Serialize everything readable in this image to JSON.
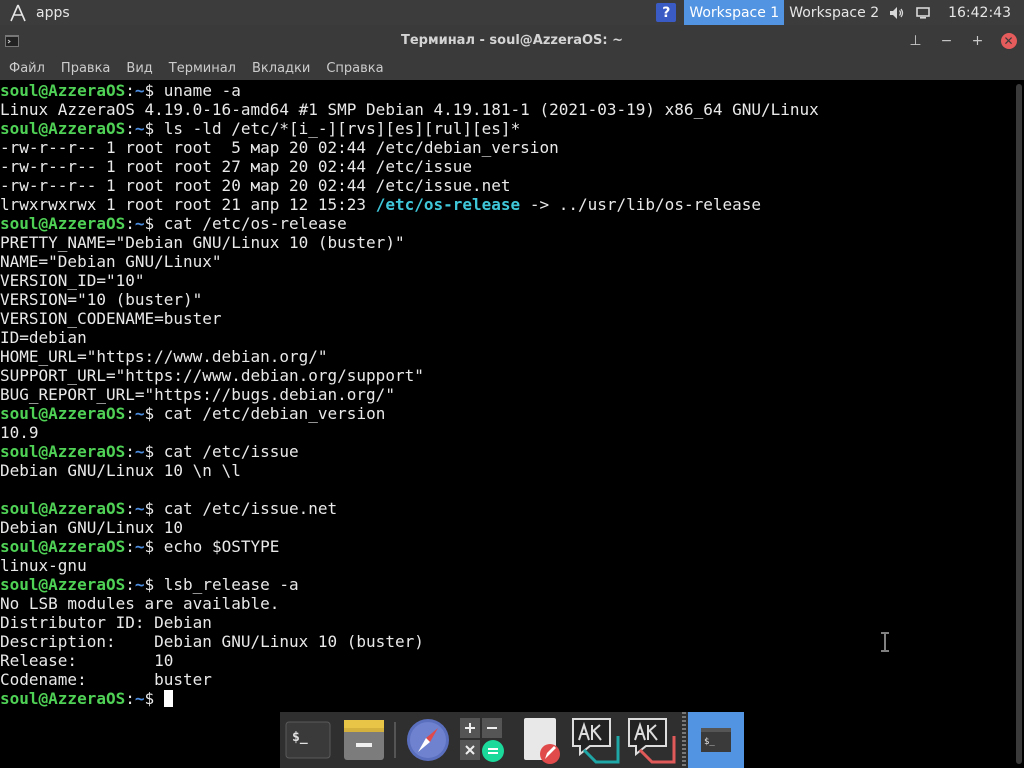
{
  "topbar": {
    "apps_label": "apps",
    "help_label": "?",
    "workspaces": [
      "Workspace 1",
      "Workspace 2"
    ],
    "active_workspace": 0,
    "clock": "16:42:43",
    "tray_icons": [
      "volume-icon",
      "display-icon"
    ]
  },
  "window": {
    "title": "Терминал - soul@AzzeraOS: ~",
    "controls": [
      "⊥",
      "−",
      "+",
      "✕"
    ]
  },
  "menu": [
    "Файл",
    "Правка",
    "Вид",
    "Терминал",
    "Вкладки",
    "Справка"
  ],
  "terminal": {
    "prompt_user": "soul@AzzeraOS",
    "prompt_sep": ":",
    "prompt_path": "~",
    "prompt_sym": "$ ",
    "lines": [
      {
        "type": "prompt",
        "cmd": "uname -a"
      },
      {
        "type": "out",
        "text": "Linux AzzeraOS 4.19.0-16-amd64 #1 SMP Debian 4.19.181-1 (2021-03-19) x86_64 GNU/Linux"
      },
      {
        "type": "prompt",
        "cmd": "ls -ld /etc/*[i_-][rvs][es][rul][es]*"
      },
      {
        "type": "out",
        "text": "-rw-r--r-- 1 root root  5 мар 20 02:44 /etc/debian_version"
      },
      {
        "type": "out",
        "text": "-rw-r--r-- 1 root root 27 мар 20 02:44 /etc/issue"
      },
      {
        "type": "out",
        "text": "-rw-r--r-- 1 root root 20 мар 20 02:44 /etc/issue.net"
      },
      {
        "type": "out",
        "text": "lrwxrwxrwx 1 root root 21 апр 12 15:23 ",
        "hl": "/etc/os-release",
        "tail": " -> ../usr/lib/os-release"
      },
      {
        "type": "prompt",
        "cmd": "cat /etc/os-release"
      },
      {
        "type": "out",
        "text": "PRETTY_NAME=\"Debian GNU/Linux 10 (buster)\""
      },
      {
        "type": "out",
        "text": "NAME=\"Debian GNU/Linux\""
      },
      {
        "type": "out",
        "text": "VERSION_ID=\"10\""
      },
      {
        "type": "out",
        "text": "VERSION=\"10 (buster)\""
      },
      {
        "type": "out",
        "text": "VERSION_CODENAME=buster"
      },
      {
        "type": "out",
        "text": "ID=debian"
      },
      {
        "type": "out",
        "text": "HOME_URL=\"https://www.debian.org/\""
      },
      {
        "type": "out",
        "text": "SUPPORT_URL=\"https://www.debian.org/support\""
      },
      {
        "type": "out",
        "text": "BUG_REPORT_URL=\"https://bugs.debian.org/\""
      },
      {
        "type": "prompt",
        "cmd": "cat /etc/debian_version"
      },
      {
        "type": "out",
        "text": "10.9"
      },
      {
        "type": "prompt",
        "cmd": "cat /etc/issue"
      },
      {
        "type": "out",
        "text": "Debian GNU/Linux 10 \\n \\l"
      },
      {
        "type": "out",
        "text": ""
      },
      {
        "type": "prompt",
        "cmd": "cat /etc/issue.net"
      },
      {
        "type": "out",
        "text": "Debian GNU/Linux 10"
      },
      {
        "type": "prompt",
        "cmd": "echo $OSTYPE"
      },
      {
        "type": "out",
        "text": "linux-gnu"
      },
      {
        "type": "prompt",
        "cmd": "lsb_release -a"
      },
      {
        "type": "out",
        "text": "No LSB modules are available."
      },
      {
        "type": "out",
        "text": "Distributor ID:\tDebian"
      },
      {
        "type": "out",
        "text": "Description:\tDebian GNU/Linux 10 (buster)"
      },
      {
        "type": "out",
        "text": "Release:\t10"
      },
      {
        "type": "out",
        "text": "Codename:\tbuster"
      },
      {
        "type": "prompt",
        "cmd": "",
        "cursor": true
      }
    ]
  },
  "dock": {
    "items": [
      "terminal-icon",
      "file-manager-icon",
      "web-browser-icon",
      "calculator-icon",
      "text-editor-icon",
      "chat-app-icon",
      "chat-app-2-icon",
      "active-terminal-icon"
    ],
    "terminal_glyph": "$_",
    "active_index": 7,
    "colors": {
      "background": "#2f2f2f",
      "active": "#5294e2",
      "accent": "#1bd99a"
    }
  },
  "colors": {
    "prompt_user": "#4fd155",
    "prompt_path": "#4d8ee0",
    "symlink": "#3fc7d9",
    "panel": "#3c3c3c",
    "workspace_active": "#5294e2",
    "close": "#e65c5c"
  }
}
